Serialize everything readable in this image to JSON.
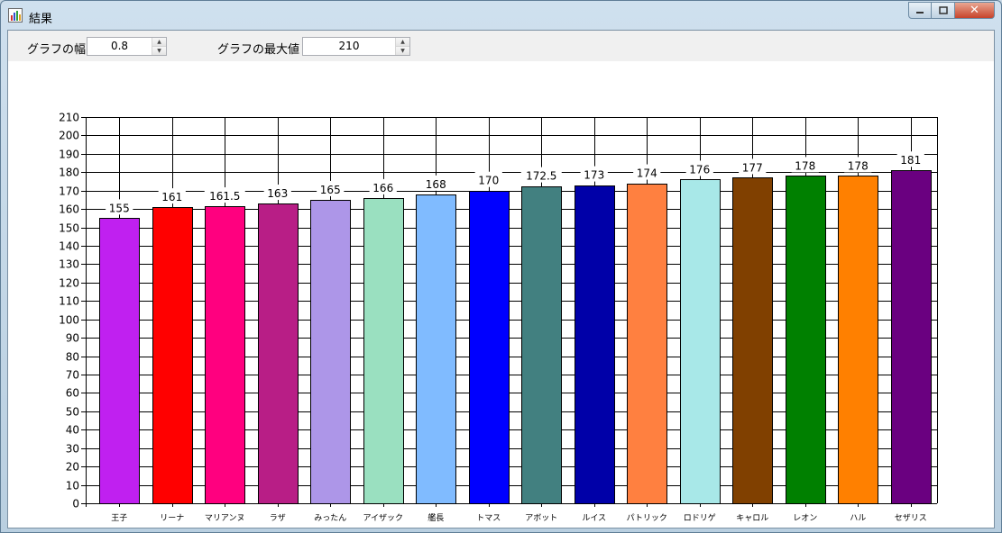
{
  "window": {
    "title": "結果",
    "close_glyph": "✕"
  },
  "toolbar": {
    "width_label": "グラフの幅",
    "width_value": "0.8",
    "max_label": "グラフの最大値",
    "max_value": "210"
  },
  "chart_data": {
    "type": "bar",
    "categories": [
      "王子",
      "リーナ",
      "マリアンヌ",
      "ラザ",
      "みったん",
      "アイザック",
      "艦長",
      "トマス",
      "アボット",
      "ルイス",
      "パトリック",
      "ロドリゲ",
      "キャロル",
      "レオン",
      "ハル",
      "セザリス"
    ],
    "values": [
      155,
      161,
      161.5,
      163,
      165,
      166,
      168,
      170,
      172.5,
      173,
      174,
      176,
      177,
      178,
      178,
      181
    ],
    "value_labels": [
      "155",
      "161",
      "161.5",
      "163",
      "165",
      "166",
      "168",
      "170",
      "172.5",
      "173",
      "174",
      "176",
      "177",
      "178",
      "178",
      "181"
    ],
    "colors": [
      "#c020f0",
      "#ff0000",
      "#ff007f",
      "#b81e86",
      "#ad96e8",
      "#9ae0c0",
      "#80bbff",
      "#0000ff",
      "#428080",
      "#0000a8",
      "#ff8040",
      "#a8e8e8",
      "#804000",
      "#008000",
      "#ff8000",
      "#6a0080"
    ],
    "ylim": [
      0,
      210
    ],
    "ytick_step": 10,
    "grid": true,
    "legend": "none"
  }
}
